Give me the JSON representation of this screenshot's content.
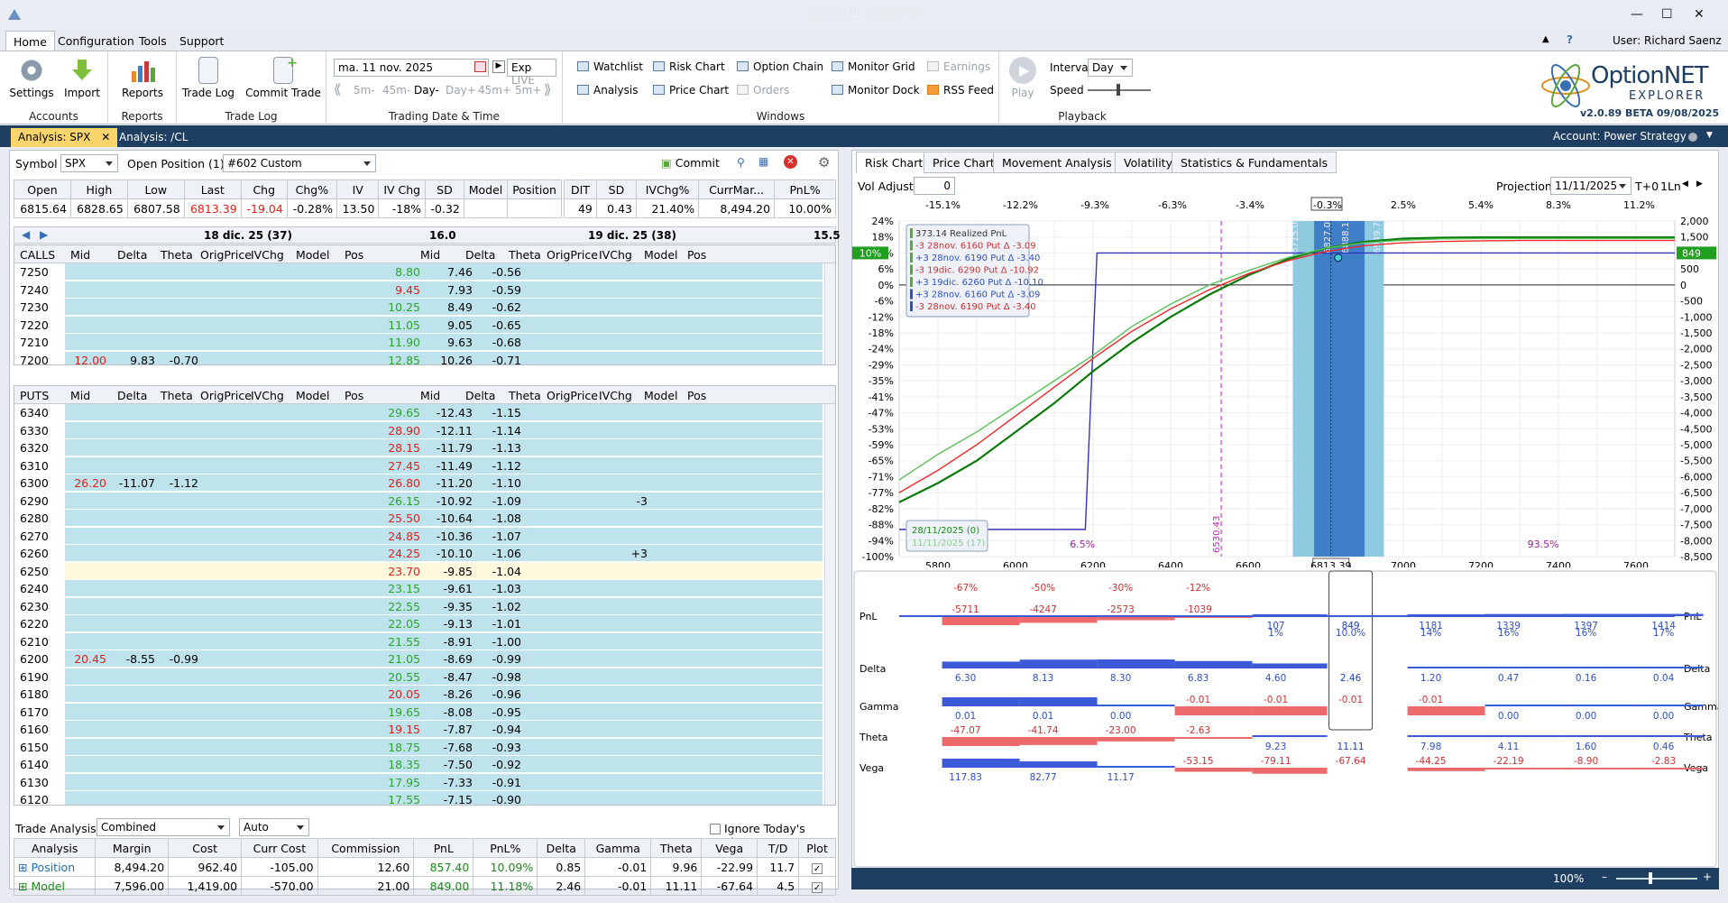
{
  "app": {
    "title": "OptionNET Explorer"
  },
  "menu": {
    "tabs": [
      "Home",
      "Configuration",
      "Tools",
      "Support"
    ],
    "user": "User: Richard Saenz"
  },
  "ribbon": {
    "accounts": {
      "label": "Accounts",
      "settings": "Settings",
      "import": "Import"
    },
    "reports": {
      "label": "Reports",
      "reports": "Reports"
    },
    "tradelog": {
      "label": "Trade Log",
      "trade_log": "Trade Log",
      "commit_trade": "Commit Trade"
    },
    "tradingdate": {
      "label": "Trading Date & Time",
      "date": "ma. 11 nov. 2025",
      "exp": "Exp",
      "live": "LIVE",
      "steps": [
        "5m-",
        "45m-",
        "Day-",
        "Day+",
        "45m+",
        "5m+"
      ]
    },
    "windows": {
      "label": "Windows",
      "items": [
        "Watchlist",
        "Risk Chart",
        "Option Chain",
        "Monitor Grid",
        "Earnings",
        "Analysis",
        "Price Chart",
        "Orders",
        "Monitor Dock",
        "RSS Feed"
      ]
    },
    "playback": {
      "label": "Playback",
      "play": "Play",
      "interval_label": "Interval",
      "interval": "Day",
      "speed": "Speed"
    },
    "logo": {
      "name": "OptionNET",
      "sub": "EXPLORER",
      "version": "v2.0.89 BETA 09/08/2025"
    }
  },
  "doctabs": {
    "tabs": [
      "Analysis: SPX",
      "Analysis: /CL"
    ],
    "account": "Account: Power Strategy"
  },
  "left": {
    "symbol_label": "Symbol",
    "symbol": "SPX",
    "open_position_label": "Open Position (1)",
    "open_position": "#602 Custom",
    "commit": "Commit",
    "quote": {
      "headers": [
        "Open",
        "High",
        "Low",
        "Last",
        "Chg",
        "Chg%",
        "IV",
        "IV Chg",
        "SD",
        "Model",
        "Position"
      ],
      "values": [
        "6815.64",
        "6828.65",
        "6807.58",
        "6813.39",
        "-19.04",
        "-0.28%",
        "13.50",
        "-18%",
        "-0.32",
        "",
        ""
      ]
    },
    "pos": {
      "headers": [
        "DIT",
        "SD",
        "IVChg%",
        "CurrMar...",
        "PnL%"
      ],
      "values": [
        "49",
        "0.43",
        "21.40%",
        "8,494.20",
        "10.00%"
      ]
    },
    "exp1": "18 dic. 25 (37)",
    "exp1_sd": "16.0",
    "exp2": "19 dic. 25 (38)",
    "exp2_sd": "15.5",
    "calls_label": "CALLS",
    "puts_label": "PUTS",
    "cols": [
      "Mid",
      "Delta",
      "Theta",
      "OrigPrice",
      "IVChg",
      "Model",
      "Pos"
    ],
    "calls": [
      [
        "7250",
        "",
        "",
        "",
        "8.80",
        "7.46",
        "-0.56",
        ""
      ],
      [
        "7240",
        "",
        "",
        "",
        "9.45",
        "7.93",
        "-0.59",
        ""
      ],
      [
        "7230",
        "",
        "",
        "",
        "10.25",
        "8.49",
        "-0.62",
        ""
      ],
      [
        "7220",
        "",
        "",
        "",
        "11.05",
        "9.05",
        "-0.65",
        ""
      ],
      [
        "7210",
        "",
        "",
        "",
        "11.90",
        "9.63",
        "-0.68",
        ""
      ],
      [
        "7200",
        "12.00",
        "9.83",
        "-0.70",
        "12.85",
        "10.26",
        "-0.71",
        ""
      ]
    ],
    "puts": [
      [
        "6340",
        "",
        "",
        "",
        "29.65",
        "-12.43",
        "-1.15",
        ""
      ],
      [
        "6330",
        "",
        "",
        "",
        "28.90",
        "-12.11",
        "-1.14",
        ""
      ],
      [
        "6320",
        "",
        "",
        "",
        "28.15",
        "-11.79",
        "-1.13",
        ""
      ],
      [
        "6310",
        "",
        "",
        "",
        "27.45",
        "-11.49",
        "-1.12",
        ""
      ],
      [
        "6300",
        "26.20",
        "-11.07",
        "-1.12",
        "26.80",
        "-11.20",
        "-1.10",
        ""
      ],
      [
        "6290",
        "",
        "",
        "",
        "26.15",
        "-10.92",
        "-1.09",
        "-3"
      ],
      [
        "6280",
        "",
        "",
        "",
        "25.50",
        "-10.64",
        "-1.08",
        ""
      ],
      [
        "6270",
        "",
        "",
        "",
        "24.85",
        "-10.36",
        "-1.07",
        ""
      ],
      [
        "6260",
        "",
        "",
        "",
        "24.25",
        "-10.10",
        "-1.06",
        "+3"
      ],
      [
        "6250",
        "",
        "",
        "",
        "23.70",
        "-9.85",
        "-1.04",
        ""
      ],
      [
        "6240",
        "",
        "",
        "",
        "23.15",
        "-9.61",
        "-1.03",
        ""
      ],
      [
        "6230",
        "",
        "",
        "",
        "22.55",
        "-9.35",
        "-1.02",
        ""
      ],
      [
        "6220",
        "",
        "",
        "",
        "22.05",
        "-9.13",
        "-1.01",
        ""
      ],
      [
        "6210",
        "",
        "",
        "",
        "21.55",
        "-8.91",
        "-1.00",
        ""
      ],
      [
        "6200",
        "20.45",
        "-8.55",
        "-0.99",
        "21.05",
        "-8.69",
        "-0.99",
        ""
      ],
      [
        "6190",
        "",
        "",
        "",
        "20.55",
        "-8.47",
        "-0.98",
        ""
      ],
      [
        "6180",
        "",
        "",
        "",
        "20.05",
        "-8.26",
        "-0.96",
        ""
      ],
      [
        "6170",
        "",
        "",
        "",
        "19.65",
        "-8.08",
        "-0.95",
        ""
      ],
      [
        "6160",
        "",
        "",
        "",
        "19.15",
        "-7.87",
        "-0.94",
        ""
      ],
      [
        "6150",
        "",
        "",
        "",
        "18.75",
        "-7.68",
        "-0.93",
        ""
      ],
      [
        "6140",
        "",
        "",
        "",
        "18.35",
        "-7.50",
        "-0.92",
        ""
      ],
      [
        "6130",
        "",
        "",
        "",
        "17.95",
        "-7.33",
        "-0.91",
        ""
      ],
      [
        "6120",
        "",
        "",
        "",
        "17.55",
        "-7.15",
        "-0.90",
        ""
      ]
    ],
    "trade_analysis_label": "Trade Analysis",
    "ta_mode": "Combined",
    "ta_auto": "Auto",
    "ignore_label": "Ignore Today's Trades",
    "ta_headers": [
      "Analysis",
      "Margin",
      "Cost",
      "Curr Cost",
      "Commission",
      "PnL",
      "PnL%",
      "Delta",
      "Gamma",
      "Theta",
      "Vega",
      "T/D",
      "Plot"
    ],
    "ta_rows": [
      [
        "Position",
        "8,494.20",
        "962.40",
        "-105.00",
        "12.60",
        "857.40",
        "10.09%",
        "0.85",
        "-0.01",
        "9.96",
        "-22.99",
        "11.7",
        ""
      ],
      [
        "Model",
        "7,596.00",
        "1,419.00",
        "-570.00",
        "21.00",
        "849.00",
        "11.18%",
        "2.46",
        "-0.01",
        "11.11",
        "-67.64",
        "4.5",
        ""
      ]
    ]
  },
  "right": {
    "tabs": [
      "Risk Chart",
      "Price Chart",
      "Movement Analysis",
      "Volatility",
      "Statistics & Fundamentals"
    ],
    "vol_adjust_label": "Vol Adjust",
    "vol_adjust": "0",
    "projection_label": "Projection",
    "projection": "11/11/2025",
    "t0": "T+0",
    "ln": "1Ln",
    "top_pct": [
      "-15.1%",
      "-12.2%",
      "-9.3%",
      "-6.3%",
      "-3.4%",
      "-0.3%",
      "2.5%",
      "5.4%",
      "8.3%",
      "11.2%"
    ],
    "left_ticks": [
      "24%",
      "18%",
      "12%",
      "6%",
      "0%",
      "-6%",
      "-12%",
      "-18%",
      "-24%",
      "-29%",
      "-35%",
      "-41%",
      "-47%",
      "-53%",
      "-59%",
      "-65%",
      "-71%",
      "-77%",
      "-82%",
      "-88%",
      "-94%",
      "-100%"
    ],
    "right_ticks": [
      "2,000",
      "1,500",
      "1,000",
      "500",
      "0",
      "-500",
      "-1,000",
      "-1,500",
      "-2,000",
      "-2,500",
      "-3,000",
      "-3,500",
      "-4,000",
      "-4,500",
      "-5,000",
      "-5,500",
      "-6,000",
      "-6,500",
      "-7,000",
      "-7,500",
      "-8,000",
      "-8,500"
    ],
    "x_ticks": [
      "5800",
      "6000",
      "6200",
      "6400",
      "6600",
      "6800",
      "7000",
      "7200",
      "7400",
      "7600"
    ],
    "x_current": "6813.39",
    "pnl_left": "10%",
    "pnl_right": "849",
    "legend": [
      "373.14 Realized PnL",
      "-3 28nov. 6160 Put Δ  -3.09",
      "+3 28nov. 6190 Put Δ  -3.40",
      "-3 19dic. 6290 Put Δ  -10.92",
      "+3 19dic. 6260 Put Δ  -10.10",
      "+3 28nov. 6160 Put Δ  -3.09",
      "-3 28nov. 6190 Put Δ  -3.40"
    ],
    "dates": [
      "28/11/2025 (0)",
      "11/11/2025 (17)"
    ],
    "annotations": {
      "p_left": "6.5%",
      "p_right": "93.5%",
      "be": "6530.43",
      "b1": "6715.08",
      "b2": "6827.02",
      "b3": "6888.11",
      "b4": "6949.78"
    },
    "chart_data": [
      {
        "type": "line",
        "x": [
          5700,
          5800,
          5900,
          6000,
          6100,
          6200,
          6300,
          6400,
          6500,
          6600,
          6700,
          6800,
          6900,
          7000,
          7100,
          7200,
          7300,
          7400,
          7500,
          7600,
          7700
        ],
        "ylim": [
          -8500,
          2000
        ],
        "xlim": [
          5700,
          7700
        ],
        "series": [
          {
            "values": [
              -7650,
              -7650,
              -7650,
              -7650,
              -7650,
              -7650,
              1000,
              1000,
              1000,
              1000,
              1000,
              1000,
              1000,
              1000,
              1000,
              1000,
              1000,
              1000,
              1000,
              1000,
              1000
            ]
          },
          {
            "values": [
              -6800,
              -6200,
              -5500,
              -4600,
              -3700,
              -2700,
              -1800,
              -1000,
              -300,
              300,
              800,
              1150,
              1350,
              1450,
              1480,
              1490,
              1490,
              1490,
              1490,
              1490,
              1490
            ]
          },
          {
            "values": [
              -6500,
              -5800,
              -5000,
              -4100,
              -3200,
              -2300,
              -1450,
              -750,
              -150,
              350,
              750,
              1050,
              1230,
              1320,
              1360,
              1380,
              1390,
              1390,
              1390,
              1390,
              1390
            ]
          },
          {
            "values": [
              -6100,
              -5300,
              -4600,
              -3800,
              -3000,
              -2200,
              -1300,
              -600,
              0,
              450,
              850,
              1150,
              1320,
              1400,
              1440,
              1450,
              1450,
              1450,
              1450,
              1450,
              1450
            ]
          }
        ],
        "colors": [
          "#3333bb",
          "#0a7a0a",
          "#ee2a2a",
          "#58c258"
        ]
      }
    ],
    "greeks": {
      "labels": [
        "PnL",
        "Delta",
        "Gamma",
        "Theta",
        "Vega"
      ],
      "pnl_top": [
        "-67%",
        "-50%",
        "-30%",
        "-12%",
        "",
        "",
        "",
        "",
        "",
        ""
      ],
      "pnl": [
        "-5711",
        "-4247",
        "-2573",
        "-1039",
        "107",
        "849",
        "1181",
        "1339",
        "1397",
        "1414"
      ],
      "pnl_pct": [
        "",
        "",
        "",
        "",
        "1%",
        "10.0%",
        "14%",
        "16%",
        "16%",
        "17%"
      ],
      "delta": [
        "6.30",
        "8.13",
        "8.30",
        "6.83",
        "4.60",
        "2.46",
        "1.20",
        "0.47",
        "0.16",
        "0.04"
      ],
      "gamma": [
        "0.01",
        "0.01",
        "0.00",
        "-0.01",
        "-0.01",
        "-0.01",
        "-0.01",
        "0.00",
        "0.00",
        "0.00"
      ],
      "theta": [
        "-47.07",
        "-41.74",
        "-23.00",
        "-2.63",
        "9.23",
        "11.11",
        "7.98",
        "4.11",
        "1.60",
        "0.46"
      ],
      "vega": [
        "117.83",
        "82.77",
        "11.17",
        "-53.15",
        "-79.11",
        "-67.64",
        "-44.25",
        "-22.19",
        "-8.90",
        "-2.83"
      ]
    },
    "zoom": "100%"
  }
}
